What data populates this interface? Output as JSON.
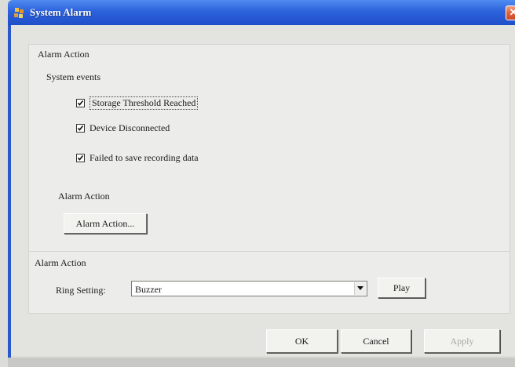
{
  "window": {
    "title": "System Alarm",
    "close_glyph": "✕"
  },
  "group1": {
    "title": "Alarm Action",
    "system_events_label": "System events",
    "checkboxes": [
      {
        "label": "Storage Threshold Reached",
        "checked": true,
        "focused": true
      },
      {
        "label": "Device Disconnected",
        "checked": true,
        "focused": false
      },
      {
        "label": "Failed to save recording data",
        "checked": true,
        "focused": false
      }
    ],
    "alarm_action_label": "Alarm Action",
    "alarm_action_button": "Alarm Action..."
  },
  "group2": {
    "title": "Alarm Action",
    "ring_setting_label": "Ring Setting:",
    "ring_setting_value": "Buzzer",
    "play_button": "Play"
  },
  "footer": {
    "ok": "OK",
    "cancel": "Cancel",
    "apply": "Apply",
    "apply_enabled": false
  },
  "colors": {
    "titlebar": "#2c62dc",
    "close": "#e0603a",
    "dialog_bg": "#e3e3df"
  }
}
